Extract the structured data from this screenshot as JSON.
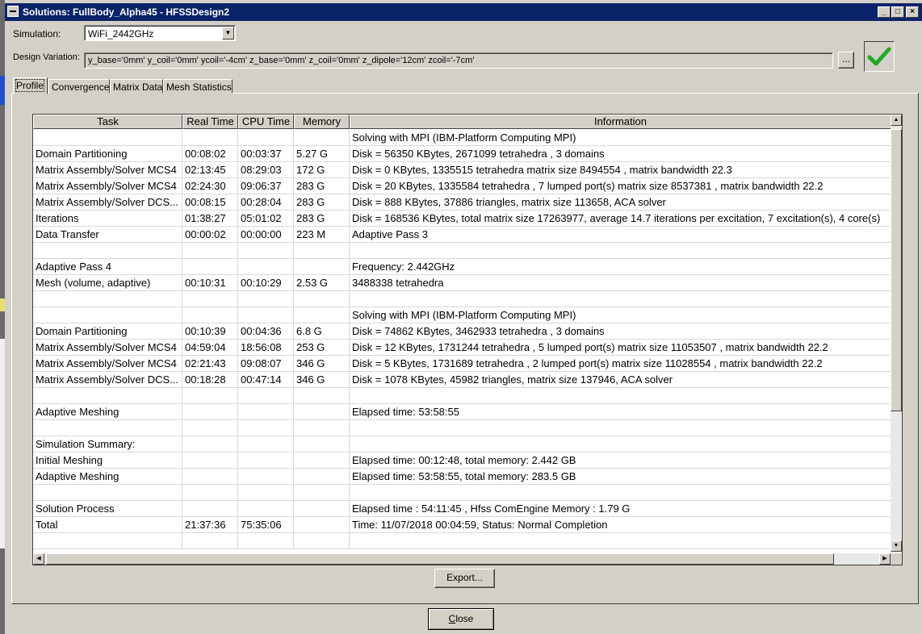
{
  "window": {
    "title": "Solutions: FullBody_Alpha45 - HFSSDesign2",
    "minimize": "_",
    "maximize": "□",
    "close": "×"
  },
  "simulation": {
    "label": "Simulation:",
    "value": "WiFi_2442GHz"
  },
  "design_variation": {
    "label": "Design Variation:",
    "value": "y_base='0mm' y_coil='0mm' ycoil='-4cm' z_base='0mm' z_coil='0mm' z_dipole='12cm' zcoil='-7cm'",
    "browse_label": "..."
  },
  "status_icon": "checkmark-icon",
  "colors": {
    "title_bar": "#0a246a",
    "check": "#22aa22",
    "face": "#d4d0c8"
  },
  "tabs": [
    {
      "label": "Profile",
      "active": true
    },
    {
      "label": "Convergence"
    },
    {
      "label": "Matrix Data"
    },
    {
      "label": "Mesh Statistics"
    }
  ],
  "table": {
    "headers": [
      "Task",
      "Real Time",
      "CPU Time",
      "Memory",
      "Information"
    ],
    "rows": [
      [
        "",
        "",
        "",
        "",
        "Solving with MPI (IBM-Platform Computing MPI)"
      ],
      [
        "Domain Partitioning",
        "00:08:02",
        "00:03:37",
        "5.27 G",
        "Disk = 56350 KBytes, 2671099 tetrahedra , 3 domains"
      ],
      [
        "Matrix Assembly/Solver MCS4",
        "02:13:45",
        "08:29:03",
        "172 G",
        "Disk = 0 KBytes, 1335515 tetrahedra matrix size 8494554 , matrix bandwidth  22.3"
      ],
      [
        "Matrix Assembly/Solver MCS4",
        "02:24:30",
        "09:06:37",
        "283 G",
        "Disk = 20 KBytes, 1335584 tetrahedra , 7 lumped port(s) matrix size 8537381 , matrix bandwidth  22.2"
      ],
      [
        "Matrix Assembly/Solver DCS...",
        "00:08:15",
        "00:28:04",
        "283 G",
        "Disk = 888 KBytes, 37886 triangles, matrix size 113658, ACA solver"
      ],
      [
        "Iterations",
        "01:38:27",
        "05:01:02",
        "283 G",
        "Disk = 168536 KBytes, total matrix size 17263977, average 14.7 iterations per excitation, 7 excitation(s), 4 core(s)"
      ],
      [
        "Data Transfer",
        "00:00:02",
        "00:00:00",
        "223 M",
        "Adaptive Pass 3"
      ],
      [
        "",
        "",
        "",
        "",
        ""
      ],
      [
        "Adaptive Pass 4",
        "",
        "",
        "",
        "Frequency:  2.442GHz"
      ],
      [
        "Mesh (volume, adaptive)",
        "00:10:31",
        "00:10:29",
        "2.53 G",
        "3488338 tetrahedra"
      ],
      [
        "",
        "",
        "",
        "",
        ""
      ],
      [
        "",
        "",
        "",
        "",
        "Solving with MPI (IBM-Platform Computing MPI)"
      ],
      [
        "Domain Partitioning",
        "00:10:39",
        "00:04:36",
        "6.8 G",
        "Disk = 74862 KBytes, 3462933 tetrahedra , 3 domains"
      ],
      [
        "Matrix Assembly/Solver MCS4",
        "04:59:04",
        "18:56:08",
        "253 G",
        "Disk = 12 KBytes, 1731244 tetrahedra , 5 lumped port(s) matrix size 11053507 , matrix bandwidth  22.2"
      ],
      [
        "Matrix Assembly/Solver MCS4",
        "02:21:43",
        "09:08:07",
        "346 G",
        "Disk = 5 KBytes, 1731689 tetrahedra , 2 lumped port(s) matrix size 11028554 , matrix bandwidth  22.2"
      ],
      [
        "Matrix Assembly/Solver DCS...",
        "00:18:28",
        "00:47:14",
        "346 G",
        "Disk = 1078 KBytes, 45982 triangles, matrix size 137946, ACA solver"
      ],
      [
        "",
        "",
        "",
        "",
        ""
      ],
      [
        "Adaptive Meshing",
        "",
        "",
        "",
        "Elapsed time: 53:58:55"
      ],
      [
        "",
        "",
        "",
        "",
        ""
      ],
      [
        "Simulation Summary:",
        "",
        "",
        "",
        ""
      ],
      [
        "Initial Meshing",
        "",
        "",
        "",
        "Elapsed time: 00:12:48, total memory: 2.442 GB"
      ],
      [
        "Adaptive Meshing",
        "",
        "",
        "",
        "Elapsed time: 53:58:55, total memory: 283.5 GB"
      ],
      [
        "",
        "",
        "",
        "",
        ""
      ],
      [
        "Solution Process",
        "",
        "",
        "",
        "Elapsed time : 54:11:45 , Hfss ComEngine Memory : 1.79 G"
      ],
      [
        "Total",
        "21:37:36",
        "75:35:06",
        "",
        "Time:  11/07/2018 00:04:59, Status: Normal Completion"
      ],
      [
        "",
        "",
        "",
        "",
        ""
      ]
    ]
  },
  "buttons": {
    "export": "Export...",
    "close_underlined": "C",
    "close_rest": "lose"
  }
}
